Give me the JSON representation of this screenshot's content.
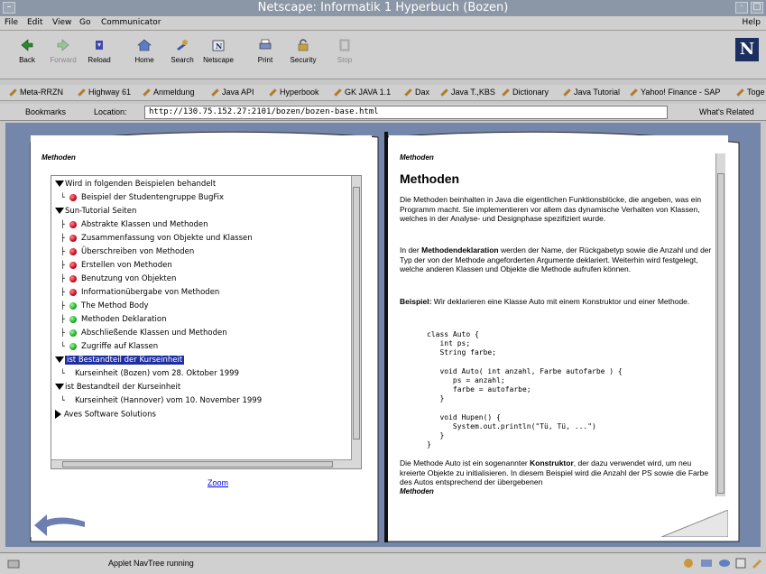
{
  "window": {
    "title": "Netscape: Informatik 1 Hyperbuch (Bozen)"
  },
  "menubar": {
    "items": [
      "File",
      "Edit",
      "View",
      "Go",
      "Communicator"
    ],
    "help": "Help"
  },
  "toolbar": {
    "buttons": [
      {
        "label": "Back",
        "icon": "back-arrow-icon",
        "enabled": true
      },
      {
        "label": "Forward",
        "icon": "forward-arrow-icon",
        "enabled": false
      },
      {
        "label": "Reload",
        "icon": "reload-icon",
        "enabled": true
      },
      {
        "label": "Home",
        "icon": "home-icon",
        "enabled": true
      },
      {
        "label": "Search",
        "icon": "search-icon",
        "enabled": true
      },
      {
        "label": "Netscape",
        "icon": "netscape-icon",
        "enabled": true
      },
      {
        "label": "Print",
        "icon": "print-icon",
        "enabled": true
      },
      {
        "label": "Security",
        "icon": "lock-icon",
        "enabled": true
      },
      {
        "label": "Stop",
        "icon": "stop-icon",
        "enabled": false
      }
    ],
    "logo": "N"
  },
  "personal_toolbar": {
    "items": [
      "Meta-RRZN",
      "Highway 61",
      "Anmeldung",
      "Java API",
      "Hyperbook",
      "GK JAVA 1.1",
      "Dax",
      "Java T.,KBS",
      "Dictionary",
      "Java Tutorial",
      "Yahoo! Finance - SAP",
      "Toge"
    ]
  },
  "location_bar": {
    "bookmarks_label": "Bookmarks",
    "location_label": "Location:",
    "url": "http://130.75.152.27:2101/bozen/bozen-base.html",
    "related_label": "What's Related"
  },
  "left_page": {
    "header": "Methoden",
    "tree": [
      {
        "type": "folder",
        "label": "Wird in folgenden Beispielen behandelt",
        "selected": false
      },
      {
        "type": "leaf",
        "dot": "red",
        "label": "Beispiel der Studentengruppe BugFix"
      },
      {
        "type": "folder",
        "label": "Sun-Tutorial Seiten",
        "selected": false
      },
      {
        "type": "leaf",
        "dot": "red",
        "label": "Abstrakte Klassen und Methoden"
      },
      {
        "type": "leaf",
        "dot": "red",
        "label": "Zusammenfassung von Objekte und Klassen"
      },
      {
        "type": "leaf",
        "dot": "red",
        "label": "Überschreiben von Methoden"
      },
      {
        "type": "leaf",
        "dot": "red",
        "label": "Erstellen von Methoden"
      },
      {
        "type": "leaf",
        "dot": "red",
        "label": "Benutzung von Objekten"
      },
      {
        "type": "leaf",
        "dot": "red",
        "label": "Informationübergabe von Methoden"
      },
      {
        "type": "leaf",
        "dot": "green",
        "label": "The Method Body"
      },
      {
        "type": "leaf",
        "dot": "green",
        "label": "Methoden Deklaration"
      },
      {
        "type": "leaf",
        "dot": "green",
        "label": "Abschließende Klassen und Methoden"
      },
      {
        "type": "leaf",
        "dot": "green",
        "label": "Zugriffe auf Klassen"
      },
      {
        "type": "folder",
        "label": "ist Bestandteil der Kurseinheit",
        "selected": true
      },
      {
        "type": "plain",
        "label": "Kurseinheit (Bozen) vom 28. Oktober 1999"
      },
      {
        "type": "folder",
        "label": "ist Bestandteil der Kurseinheit",
        "selected": false
      },
      {
        "type": "plain",
        "label": "Kurseinheit (Hannover) vom 10. November 1999"
      },
      {
        "type": "collapsed",
        "label": "Aves Software Solutions"
      }
    ],
    "zoom_link": "Zoom"
  },
  "right_page": {
    "header": "Methoden",
    "heading": "Methoden",
    "para1": "Die Methoden beinhalten in Java die eigentlichen Funktionsblöcke, die angeben, was ein Programm macht. Sie implementieren vor allem das dynamische Verhalten von Klassen, welches in der Analyse- und Designphase spezifiziert wurde.",
    "para2_pre": "In der ",
    "para2_bold": "Methodendeklaration",
    "para2_post": " werden der Name, der Rückgabetyp sowie die Anzahl und der Typ der von der Methode angeforderten Argumente deklariert. Weiterhin wird festgelegt, welche anderen Klassen und Objekte die Methode aufrufen können.",
    "para3_bold": "Beispiel:",
    "para3_post": " Wir deklarieren eine Klasse Auto mit einem Konstruktor und einer Methode.",
    "code": "class Auto {\n   int ps;\n   String farbe;\n\n   void Auto( int anzahl, Farbe autofarbe ) {\n      ps = anzahl;\n      farbe = autofarbe;\n   }\n\n   void Hupen() {\n      System.out.println(\"Tü, Tü, ...\")\n   }\n}",
    "para4_pre": "Die Methode Auto ist ein sogenannter ",
    "para4_bold": "Konstruktor",
    "para4_post": ", der dazu verwendet wird, um neu kreierte Objekte zu initialisieren. In diesem Beispiel wird die Anzahl der PS sowie die Farbe des Autos entsprechend der übergebenen",
    "footer": "Methoden"
  },
  "statusbar": {
    "text": "Applet NavTree running"
  },
  "colors": {
    "content_bg": "#7487aa",
    "selection": "#1f2fa2",
    "link": "#0000ee"
  }
}
